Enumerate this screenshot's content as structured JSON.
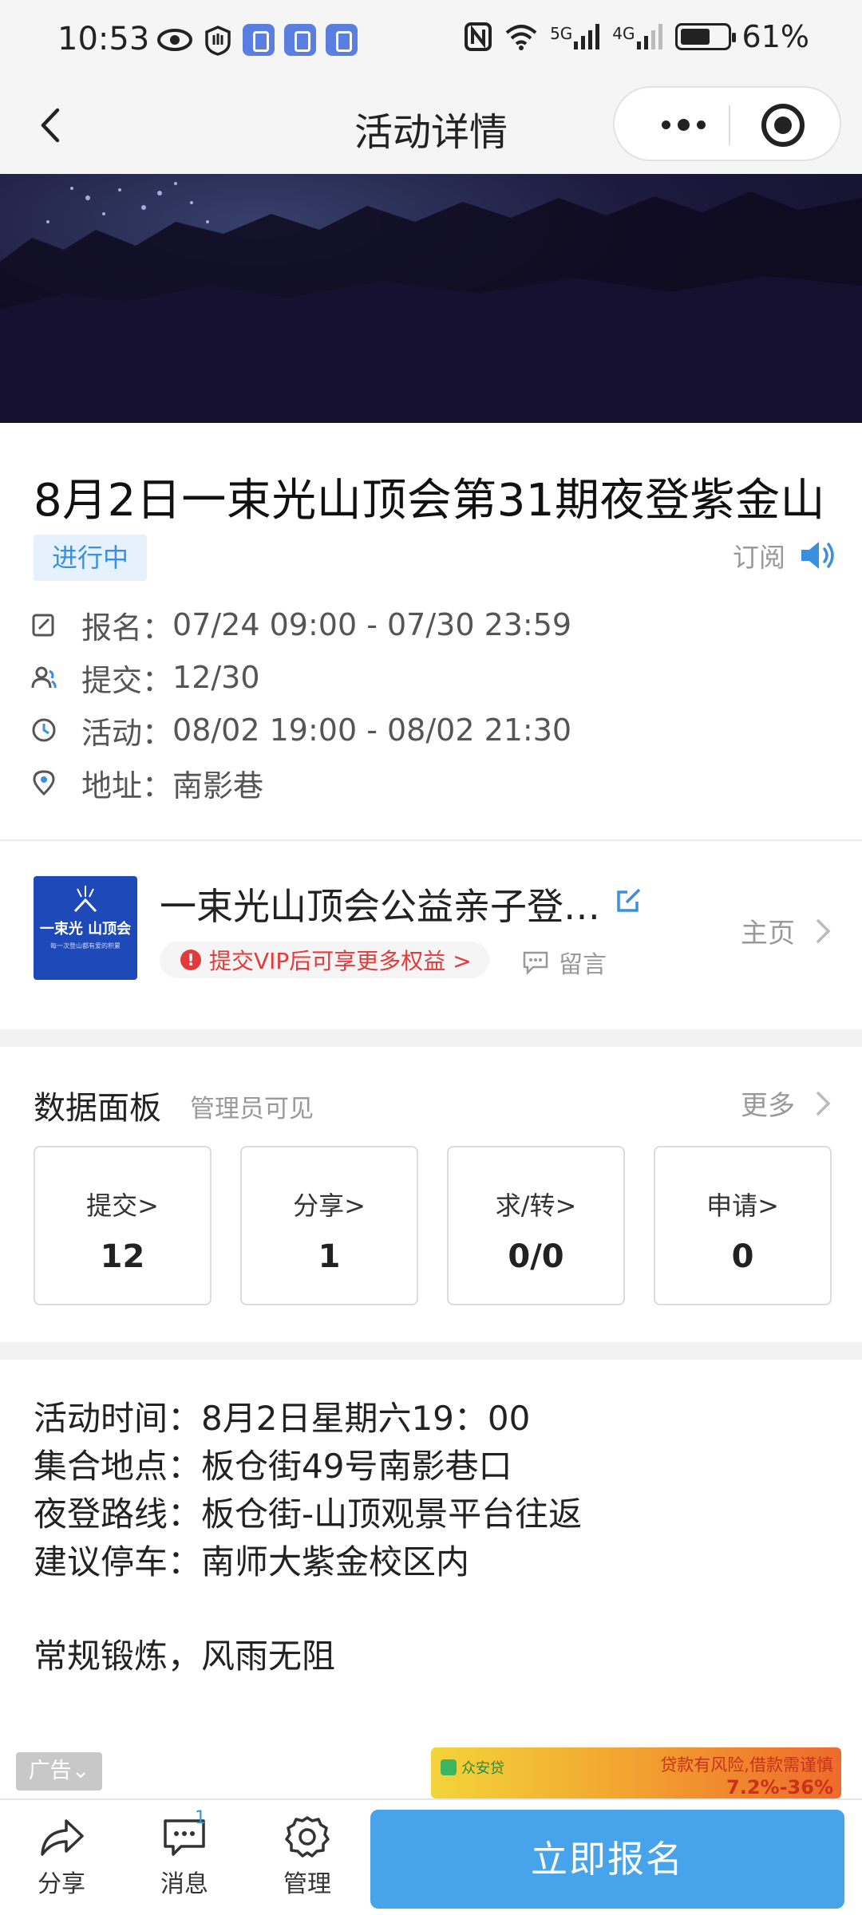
{
  "status_bar": {
    "time": "10:53",
    "net1": "5G",
    "net2": "4G",
    "battery": "61%"
  },
  "nav": {
    "title": "活动详情"
  },
  "event": {
    "title": "8月2日一束光山顶会第31期夜登紫金山",
    "status": "进行中",
    "subscribe_label": "订阅",
    "registration_label": "报名：",
    "registration_value": "07/24 09:00 - 07/30 23:59",
    "submitted_label": "提交：",
    "submitted_value": "12/30",
    "activity_label": "活动：",
    "activity_value": "08/02 19:00 - 08/02 21:30",
    "address_label": "地址：",
    "address_value": "南影巷"
  },
  "organizer": {
    "logo_text": "一束光 山顶会",
    "logo_subtext": "每一次登山都有爱的积累",
    "name": "一束光山顶会公益亲子登…",
    "vip_text": "提交VIP后可享更多权益 >",
    "message_label": "留言",
    "home_label": "主页"
  },
  "data_panel": {
    "title": "数据面板",
    "subtitle": "管理员可见",
    "more_label": "更多",
    "stats": [
      {
        "label": "提交>",
        "value": "12"
      },
      {
        "label": "分享>",
        "value": "1"
      },
      {
        "label": "求/转>",
        "value": "0/0"
      },
      {
        "label": "申请>",
        "value": "0"
      }
    ]
  },
  "description": {
    "line1": "活动时间：8月2日星期六19：00",
    "line2": "集合地点：板仓街49号南影巷口",
    "line3": "夜登路线：板仓街-山顶观景平台往返",
    "line4": "建议停车：南师大紫金校区内",
    "line5": "常规锻炼，风雨无阻"
  },
  "ad": {
    "tag": "广告",
    "brand": "众安贷",
    "headline": "贷款有风险,借款需谨慎",
    "rate": "7.2%-36%"
  },
  "bottom_bar": {
    "share_label": "分享",
    "message_label": "消息",
    "message_badge": "1",
    "manage_label": "管理",
    "signup_label": "立即报名"
  },
  "colors": {
    "accent": "#48a4ea",
    "status_tag_text": "#3a8fe0",
    "vip_red": "#e23b3b"
  }
}
